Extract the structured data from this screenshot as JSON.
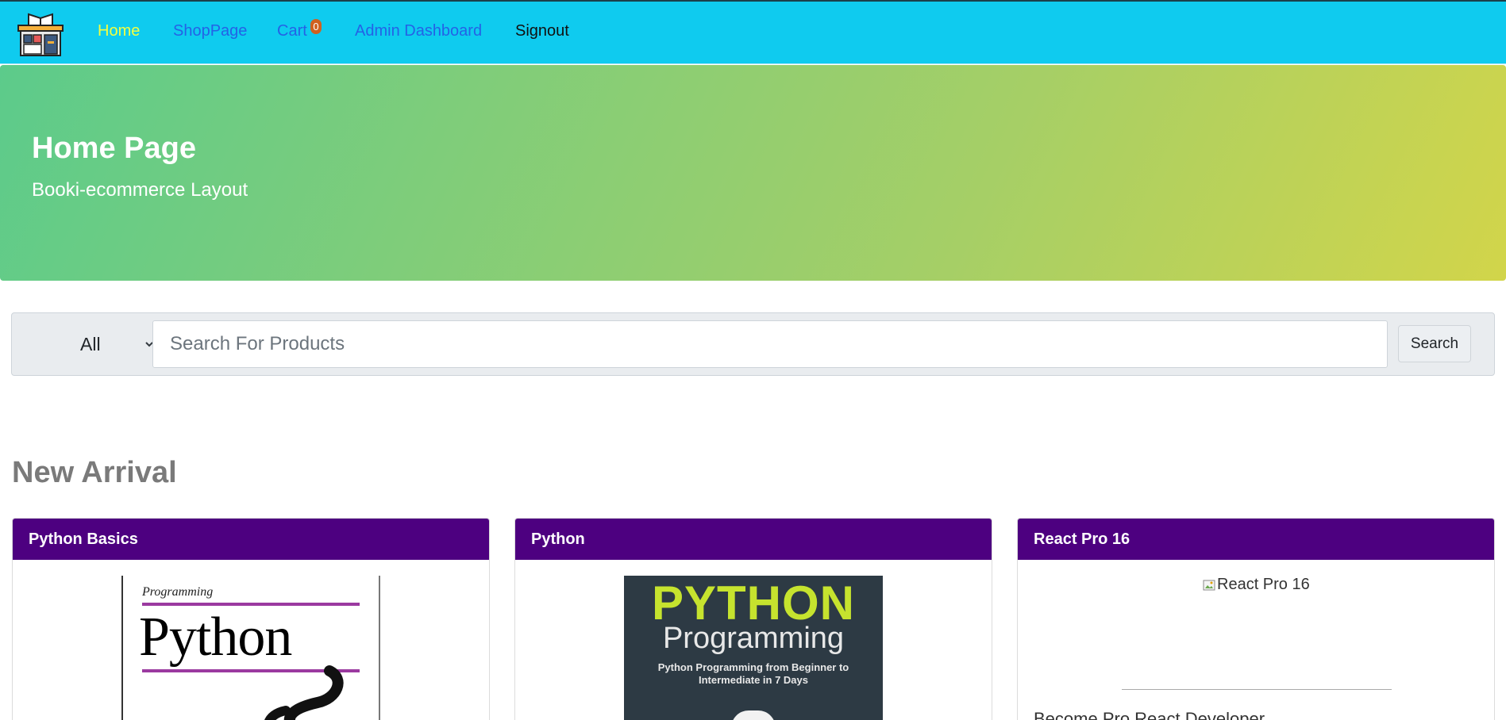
{
  "nav": {
    "logo": "bookstore-logo-icon",
    "items": [
      {
        "label": "Home",
        "active": true
      },
      {
        "label": "ShopPage"
      },
      {
        "label": "Cart"
      },
      {
        "label": "Admin Dashboard"
      },
      {
        "label": "Signout"
      }
    ],
    "cart_count": "0",
    "colors": {
      "bar": "#0fcbef",
      "active": "#f4ff3f",
      "link": "#2462e6",
      "badge": "#d0611f"
    }
  },
  "hero": {
    "title": "Home Page",
    "subtitle": "Booki-ecommerce Layout"
  },
  "search": {
    "category": "All",
    "placeholder": "Search For Products",
    "value": "",
    "button_label": "Search"
  },
  "section": {
    "title": "New Arrival"
  },
  "products": [
    {
      "name": "Python Basics",
      "cover": {
        "series": "Programming",
        "title": "Python"
      }
    },
    {
      "name": "Python",
      "cover": {
        "title": "PYTHON",
        "subtitle": "Programming",
        "tagline_1": "Python Programming from Beginner to",
        "tagline_2": "Intermediate in 7 Days"
      }
    },
    {
      "name": "React Pro 16",
      "image_alt": "React Pro 16",
      "description": "Become Pro React Developer"
    }
  ],
  "colors": {
    "card_header": "#4d0080"
  }
}
